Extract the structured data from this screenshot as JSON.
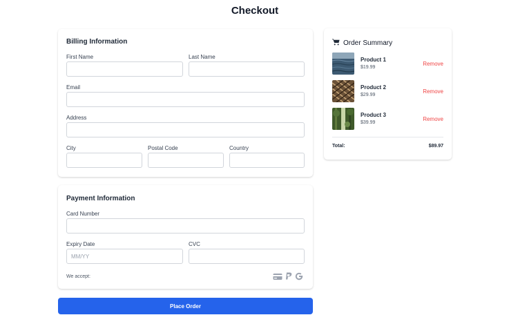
{
  "page": {
    "title": "Checkout"
  },
  "billing": {
    "heading": "Billing Information",
    "first_name": {
      "label": "First Name",
      "value": "",
      "placeholder": ""
    },
    "last_name": {
      "label": "Last Name",
      "value": "",
      "placeholder": ""
    },
    "email": {
      "label": "Email",
      "value": "",
      "placeholder": ""
    },
    "address": {
      "label": "Address",
      "value": "",
      "placeholder": ""
    },
    "city": {
      "label": "City",
      "value": "",
      "placeholder": ""
    },
    "postal_code": {
      "label": "Postal Code",
      "value": "",
      "placeholder": ""
    },
    "country": {
      "label": "Country",
      "value": "",
      "placeholder": ""
    }
  },
  "payment": {
    "heading": "Payment Information",
    "card_number": {
      "label": "Card Number",
      "value": "",
      "placeholder": ""
    },
    "expiry": {
      "label": "Expiry Date",
      "value": "",
      "placeholder": "MM/YY"
    },
    "cvc": {
      "label": "CVC",
      "value": "",
      "placeholder": ""
    },
    "accept_label": "We accept:",
    "accepted_methods": [
      "credit-card-icon",
      "paypal-icon",
      "google-icon"
    ]
  },
  "actions": {
    "place_order_label": "Place Order"
  },
  "summary": {
    "heading": "Order Summary",
    "icon": "cart-icon",
    "items": [
      {
        "name": "Product 1",
        "price": "$19.99",
        "remove_label": "Remove",
        "image": "ocean-thumbnail"
      },
      {
        "name": "Product 2",
        "price": "$29.99",
        "remove_label": "Remove",
        "image": "net-thumbnail"
      },
      {
        "name": "Product 3",
        "price": "$39.99",
        "remove_label": "Remove",
        "image": "forest-thumbnail"
      }
    ],
    "total_label": "Total:",
    "total_value": "$89.97"
  },
  "colors": {
    "accent": "#2563eb",
    "remove": "#ef4444",
    "border": "#d1d5db"
  }
}
